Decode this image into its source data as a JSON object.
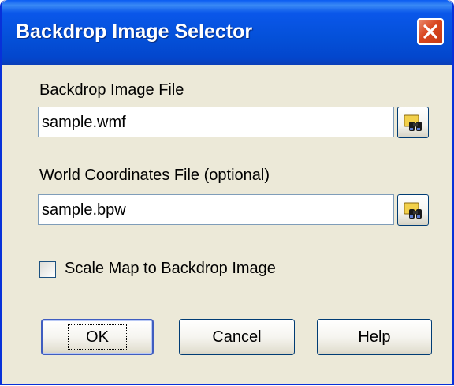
{
  "window": {
    "title": "Backdrop Image Selector"
  },
  "backdrop": {
    "label": "Backdrop Image File",
    "value": "sample.wmf"
  },
  "world": {
    "label": "World Coordinates File (optional)",
    "value": "sample.bpw"
  },
  "scale": {
    "label": "Scale Map to Backdrop Image",
    "checked": false
  },
  "buttons": {
    "ok": "OK",
    "cancel": "Cancel",
    "help": "Help"
  },
  "icons": {
    "close": "close-icon",
    "browse": "binoculars-icon"
  }
}
